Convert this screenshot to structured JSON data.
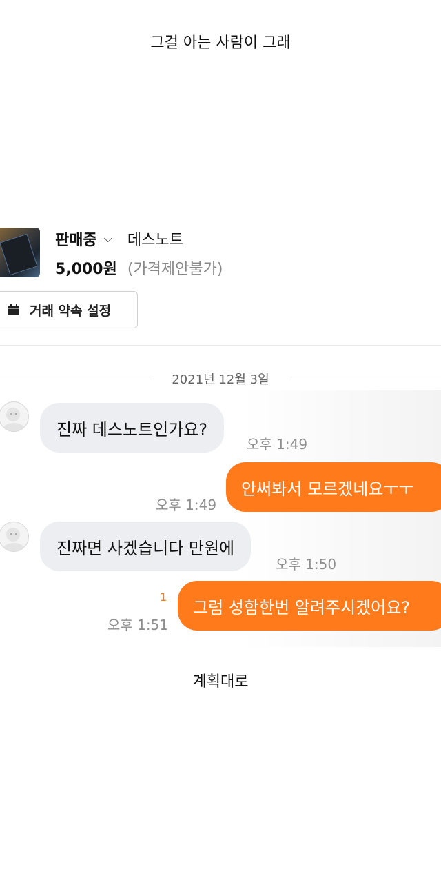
{
  "captions": {
    "top": "그걸 아는 사람이 그래",
    "bottom": "계획대로"
  },
  "product": {
    "status": "판매중",
    "status_chevron": "⌵",
    "title": "데스노트",
    "price": "5,000원",
    "price_note": "(가격제안불가)"
  },
  "schedule_button": {
    "icon": "calendar-icon",
    "label": "거래 약속 설정"
  },
  "chat": {
    "date": "2021년 12월 3일",
    "messages": [
      {
        "side": "in",
        "text": "진짜 데스노트인가요?",
        "time": "오후 1:49"
      },
      {
        "side": "out",
        "text": "안써봐서 모르겠네요ㅜㅜ",
        "time": "오후 1:49"
      },
      {
        "side": "in",
        "text": "진짜면 사겠습니다 만원에",
        "time": "오후 1:50"
      },
      {
        "side": "out",
        "text": "그럼 성함한번 알려주시겠어요?",
        "time": "오후 1:51",
        "unread": "1"
      }
    ]
  },
  "colors": {
    "accent": "#ff7a1a",
    "incoming_bubble": "#eceef1"
  }
}
